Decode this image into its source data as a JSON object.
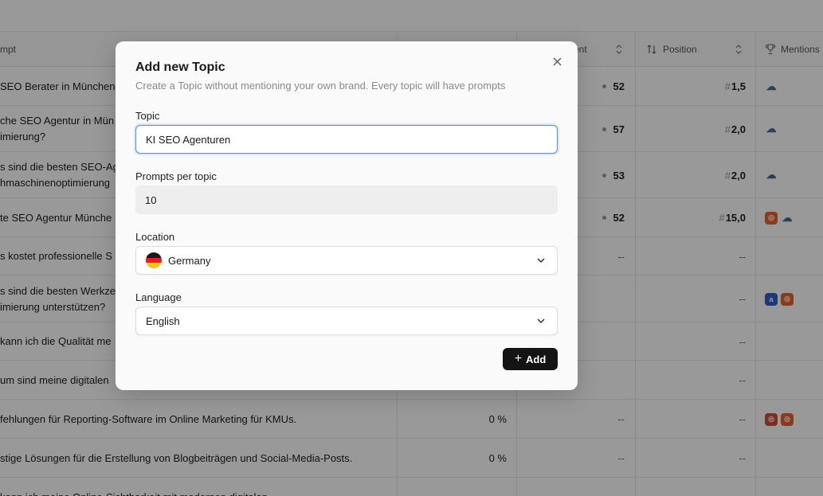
{
  "table": {
    "headers": {
      "prompt": "mpt",
      "sentiment": "ent",
      "position": "Position",
      "mentions": "Mentions"
    },
    "rows": [
      {
        "prompt": "SEO Berater in München",
        "visibility": "",
        "sentiment": "52",
        "position": "1,5",
        "mentions": [
          "cloud"
        ]
      },
      {
        "prompt": "che SEO Agentur in Mün\nimierung?",
        "visibility": "",
        "sentiment": "57",
        "position": "2,0",
        "mentions": [
          "cloud"
        ]
      },
      {
        "prompt": "s sind die besten SEO-Ag\nhmaschinenoptimierung",
        "visibility": "",
        "sentiment": "53",
        "position": "2,0",
        "mentions": [
          "cloud"
        ]
      },
      {
        "prompt": "te SEO Agentur Münche",
        "visibility": "",
        "sentiment": "52",
        "position": "15,0",
        "mentions": [
          "orange",
          "cloud"
        ]
      },
      {
        "prompt": "s kostet professionelle S",
        "visibility": "",
        "sentiment": "--",
        "position": "--",
        "mentions": []
      },
      {
        "prompt": "s sind die besten Werkze\nimierung unterstützen?",
        "visibility": "",
        "sentiment": "",
        "position": "--",
        "mentions": [
          "blue",
          "orange"
        ]
      },
      {
        "prompt": "kann ich die Qualität me",
        "visibility": "",
        "sentiment": "",
        "position": "--",
        "mentions": []
      },
      {
        "prompt": "um sind meine digitalen",
        "visibility": "",
        "sentiment": "",
        "position": "--",
        "mentions": []
      },
      {
        "prompt": "fehlungen für Reporting-Software im Online Marketing für KMUs.",
        "visibility": "0 %",
        "sentiment": "--",
        "position": "--",
        "mentions": [
          "red",
          "orange"
        ]
      },
      {
        "prompt": "stige Lösungen für die Erstellung von Blogbeiträgen und Social-Media-Posts.",
        "visibility": "0 %",
        "sentiment": "--",
        "position": "--",
        "mentions": []
      },
      {
        "prompt": "kann ich meine Online-Sichtbarkeit mit modernen digitalen",
        "visibility": "",
        "sentiment": "",
        "position": "",
        "mentions": []
      }
    ]
  },
  "modal": {
    "title": "Add new Topic",
    "subtitle": "Create a Topic without mentioning your own brand. Every topic will have prompts",
    "topic_label": "Topic",
    "topic_value": "KI SEO Agenturen",
    "prompts_label": "Prompts per topic",
    "prompts_value": "10",
    "location_label": "Location",
    "location_value": "Germany",
    "language_label": "Language",
    "language_value": "English",
    "add_label": "Add"
  },
  "colors": {
    "accent_focus": "#5b8def",
    "button_bg": "#141414",
    "overlay": "rgba(0,0,0,0.40)"
  }
}
